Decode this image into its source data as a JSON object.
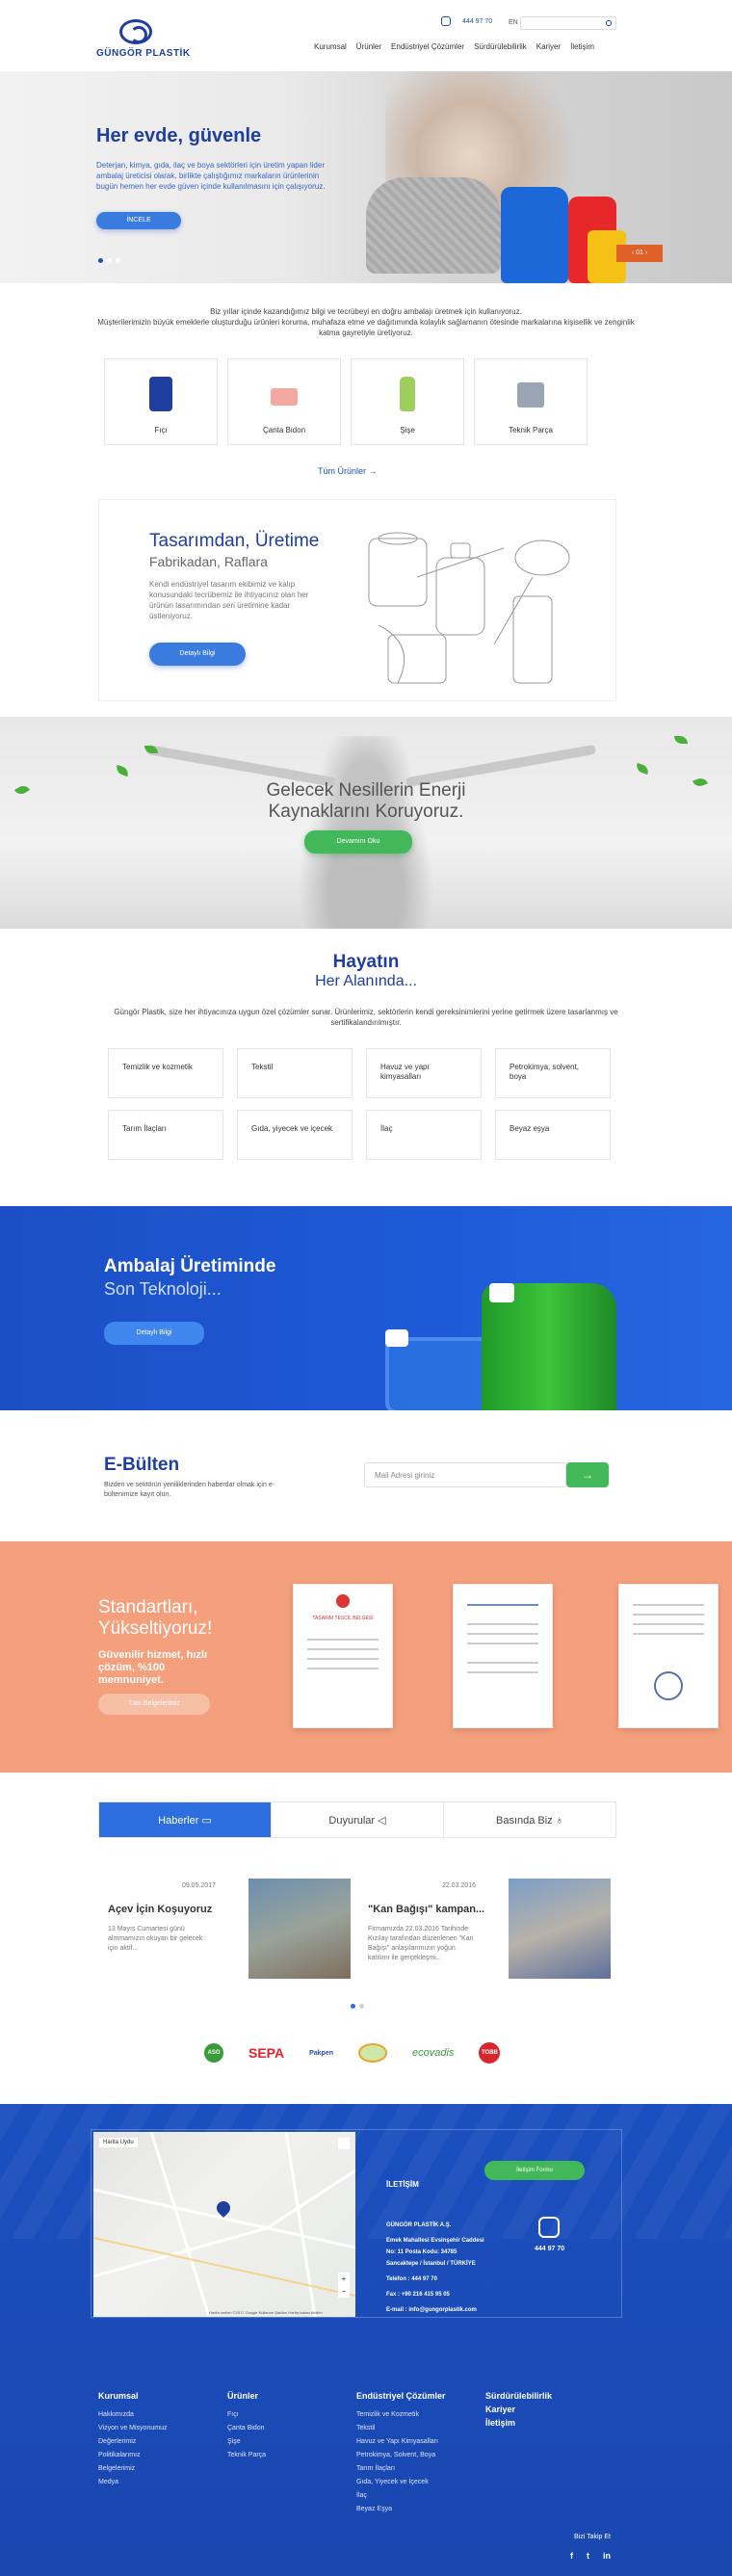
{
  "header": {
    "logo_text": "GÜNGÖR PLASTİK",
    "phone": "444 97 70",
    "lang": "EN",
    "nav": [
      "Kurumsal",
      "Ürünler",
      "Endüstriyel Çözümler",
      "Sürdürülebilirlik",
      "Kariyer",
      "İletişim"
    ]
  },
  "hero": {
    "title": "Her evde, güvenle",
    "text": "Deterjan, kimya, gıda, ilaç ve boya sektörleri için üretim yapan lider ambalaj üreticisi olarak, birlikte çalıştığımız markaların ürünlerinin bugün hemen her evde güven içinde kullanılmasını için çalışıyoruz.",
    "button": "İNCELE",
    "slide_nav": "01"
  },
  "intro": {
    "text1": "Biz yıllar içinde kazandığımız bilgi ve tecrübeyi en doğru ambalajı üretmek için kullanıyoruz.",
    "text2": "Müşterilerimizin büyük emeklerle oluşturduğu ürünleri koruma, muhafaza etme ve dağıtımında kolaylık sağlamanın ötesinde markalarına kişisellik ve zenginlik katma gayretiyle üretiyoruz."
  },
  "products": [
    {
      "label": "Fıçı",
      "icon": "barrel-icon"
    },
    {
      "label": "Çanta Bidon",
      "icon": "canister-icon"
    },
    {
      "label": "Şişe",
      "icon": "bottle-icon"
    },
    {
      "label": "Teknik Parça",
      "icon": "technical-part-icon"
    }
  ],
  "all_products": "Tüm Ürünler",
  "design": {
    "title": "Tasarımdan, Üretime",
    "subtitle": "Fabrikadan, Raflara",
    "text": "Kendi endüstriyel tasarım ekibimiz ve kalıp konusundaki tecrübemiz ile ihtiyacınız olan her ürünün tasarımından seri üretimine kadar üstleniyoruz.",
    "button": "Detaylı Bilgi"
  },
  "future": {
    "line1": "Gelecek Nesillerin Enerji",
    "line2": "Kaynaklarını Koruyoruz.",
    "button": "Devamını Oku"
  },
  "life": {
    "title": "Hayatın",
    "subtitle": "Her Alanında...",
    "text": "Güngör Plastik, size her ihtiyacınıza uygun özel çözümler sunar. Ürünlerimiz, sektörlerin kendi gereksinimlerini yerine getirmek üzere tasarlanmış ve sertifikalandırılmıştır.",
    "sectors": [
      "Temizlik ve kozmetik",
      "Tekstil",
      "Havuz ve yapı kimyasalları",
      "Petrokimya, solvent, boya",
      "Tarım İlaçları",
      "Gıda, yiyecek ve içecek",
      "İlaç",
      "Beyaz eşya"
    ]
  },
  "packaging": {
    "title": "Ambalaj Üretiminde",
    "subtitle": "Son Teknoloji...",
    "button": "Detaylı Bilgi"
  },
  "newsletter": {
    "title": "E-Bülten",
    "text": "Bizden ve sektörün yeniliklerinden haberdar olmak için e-bültenimize kayıt olun.",
    "placeholder": "Mail Adresi giriniz",
    "button": "→"
  },
  "standards": {
    "title1": "Standartları,",
    "title2": "Yükseltiyoruz!",
    "text": "Güvenilir hizmet, hızlı çözüm, %100 memnuniyet.",
    "button": "Tüm Belgelerimiz",
    "cert1_title": "TASARIM TESCİL BELGESİ"
  },
  "tabs": [
    "Haberler",
    "Duyurular",
    "Basında Biz"
  ],
  "news": [
    {
      "date": "09.05.2017",
      "title": "Açev İçin Koşuyoruz",
      "text": "13 Mayıs Cumartesi günü almmamızın okuyan bir gelecek için aktif..."
    },
    {
      "date": "22.03.2016",
      "title": "\"Kan Bağışı\" kampan...",
      "text": "Firmamızda 22.03.2016 Tarihinde Kızılay tarafından düzenlenen \"Kan Bağışı\" anlaşılarımızın yoğun katılımı ile gerçekleşmi..."
    }
  ],
  "brands": [
    "ASO",
    "SEPA",
    "Pakpen",
    "",
    "ecovadis",
    "TOBB"
  ],
  "footer": {
    "contact_title": "İLETİŞİM",
    "contact_button": "İletişim Formu",
    "company": "GÜNGÖR PLASTİK A.Ş.",
    "address1": "Emek Mahallesi Evsinşehir Caddesi",
    "address2": "No: 11 Posta Kodu: 34785",
    "address3": "Sancaktepe / İstanbul / TÜRKİYE",
    "tel": "Telefon : 444 97 70",
    "fax": "Fax : +90 216 415 95 05",
    "email": "E-mail : info@gungorplastik.com",
    "phone_big": "444 97 70",
    "map_tabs": [
      "Harita",
      "Uydu"
    ],
    "map_footer": "Harita verileri ©2017 Google   Kullanım Şartları   Harita hatası bildirin",
    "columns": [
      {
        "head": "Kurumsal",
        "items": [
          "Hakkımızda",
          "Vizyon ve Misyonumuz",
          "Değerlerimiz",
          "Politikalarımız",
          "Belgelerimiz",
          "Medya"
        ]
      },
      {
        "head": "Ürünler",
        "items": [
          "Fıçı",
          "Çanta Bidon",
          "Şişe",
          "Teknik Parça"
        ]
      },
      {
        "head": "Endüstriyel Çözümler",
        "items": [
          "Temizlik ve Kozmetik",
          "Tekstil",
          "Havuz ve Yapı Kimyasalları",
          "Petrokimya, Solvent, Boya",
          "Tarım İlaçları",
          "Gıda, Yiyecek ve İçecek",
          "İlaç",
          "Beyaz Eşya"
        ]
      },
      {
        "head": "Sürdürülebilirlik",
        "items": [
          "Kariyer",
          "İletişim"
        ]
      }
    ],
    "follow": "Bizi Takip Et",
    "social": [
      "f",
      "t",
      "in"
    ]
  }
}
